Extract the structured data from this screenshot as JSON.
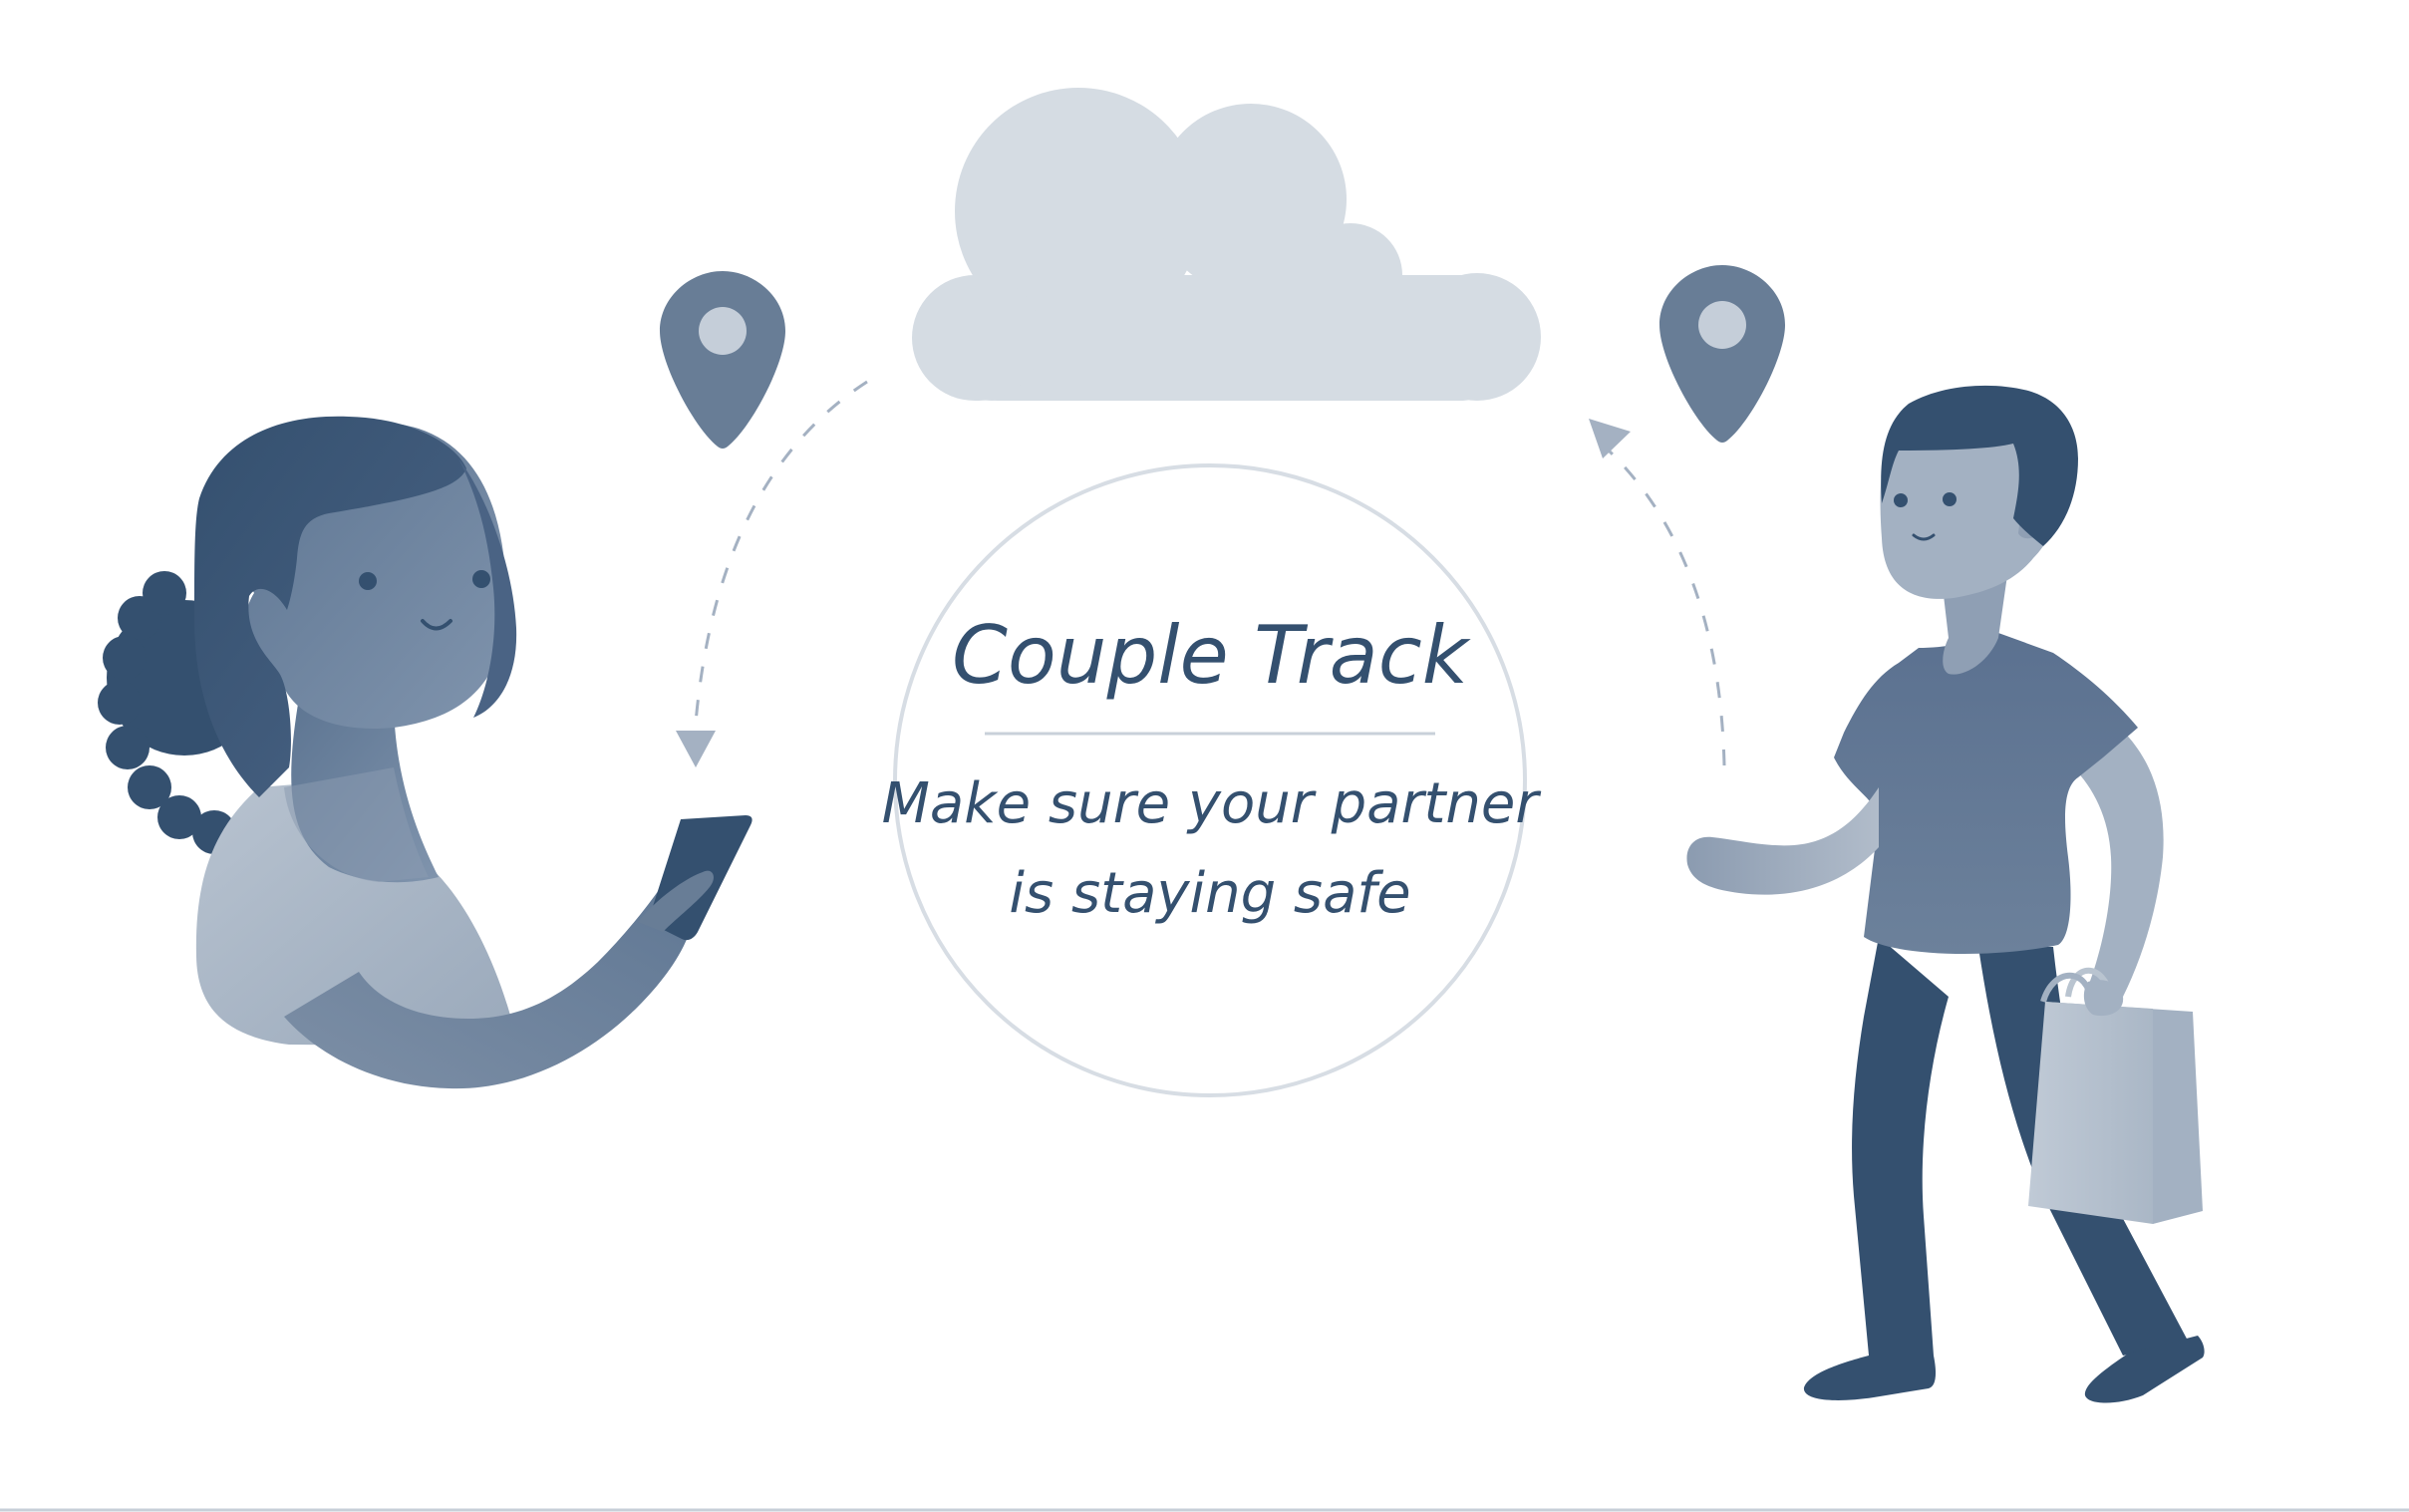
{
  "brand": {
    "title": "Couple Track",
    "tagline_line1": "Make sure your partner",
    "tagline_line2": "is staying safe"
  },
  "colors": {
    "navy": "#34506f",
    "slate": "#687d96",
    "mid": "#9fadbf",
    "light": "#b9c4d0",
    "cloud": "#d5dce3",
    "circle_stroke": "#d7dde4"
  },
  "icons": [
    "cloud-icon",
    "location-pin-icon",
    "phone-icon",
    "shopping-bag-icon"
  ]
}
